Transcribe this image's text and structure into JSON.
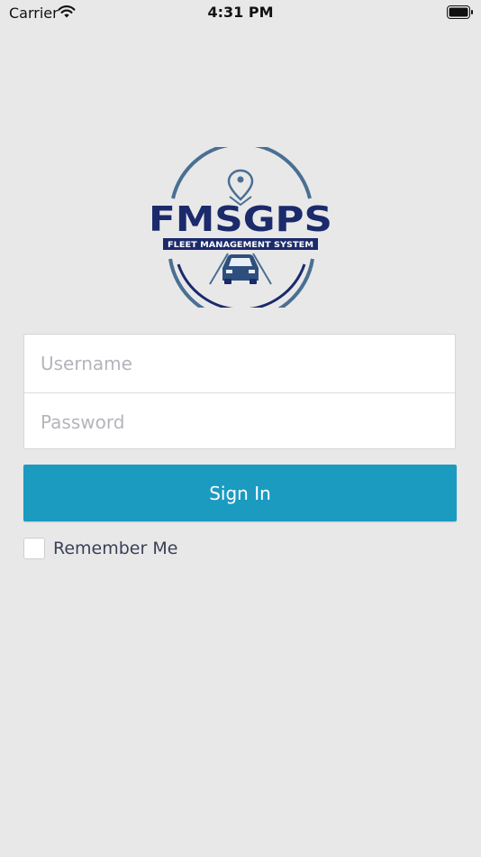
{
  "status_bar": {
    "carrier": "Carrier",
    "time": "4:31 PM"
  },
  "logo": {
    "brand": "FMSGPS",
    "tagline": "FLEET MANAGEMENT SYSTEM",
    "colors": {
      "navy": "#1b2a6b",
      "steel": "#4a6f93"
    }
  },
  "login": {
    "username_placeholder": "Username",
    "password_placeholder": "Password",
    "username_value": "",
    "password_value": "",
    "signin_label": "Sign In",
    "remember_label": "Remember Me",
    "remember_checked": false
  },
  "colors": {
    "background": "#e8e8e8",
    "accent": "#1b9bc0"
  }
}
